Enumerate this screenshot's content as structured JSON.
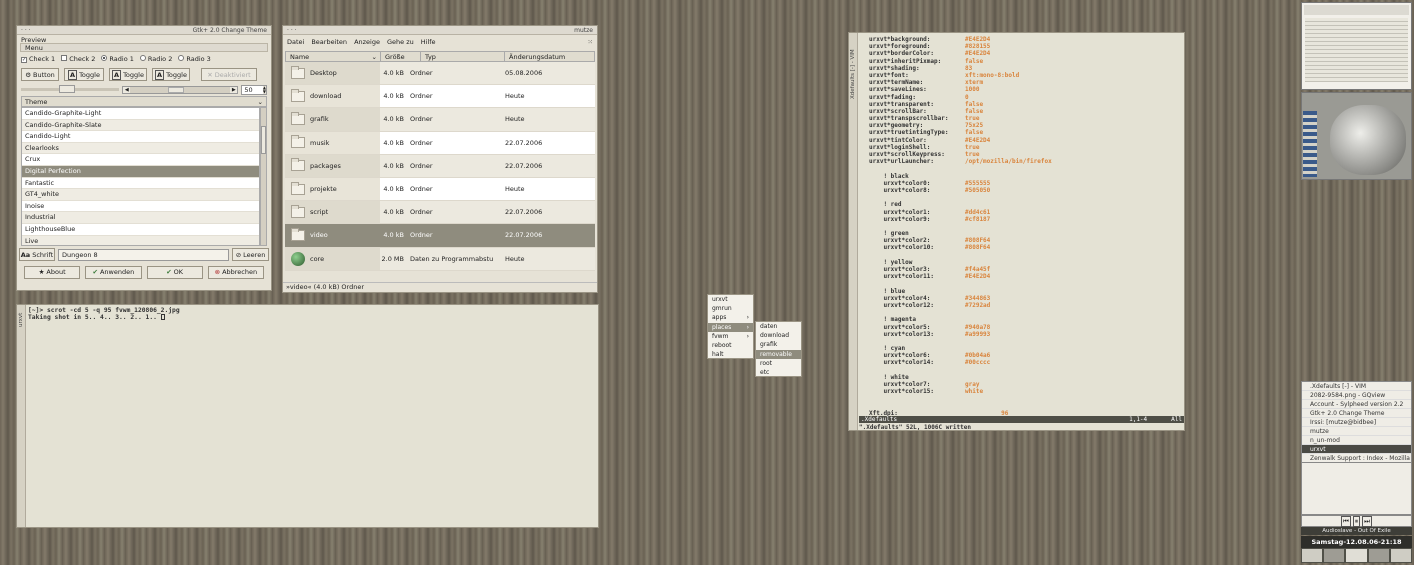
{
  "gtk": {
    "title": "Gtk+ 2.0 Change Theme",
    "preview": "Preview",
    "menu": "Menu",
    "check1": "Check 1",
    "check2": "Check 2",
    "radio1": "Radio 1",
    "radio2": "Radio 2",
    "radio3": "Radio 3",
    "button": "Button",
    "toggle": "Toggle",
    "disabled": "Deaktiviert",
    "spin": "50",
    "theme_header": "Theme",
    "themes": [
      "Candido-Graphite-Light",
      "Candido-Graphite-Slate",
      "Candido-Light",
      "Clearlooks",
      "Crux",
      "Digital Perfection",
      "Fantastic",
      "GT4_white",
      "Inoise",
      "Industrial",
      "LighthouseBlue",
      "Live"
    ],
    "font_label": "Schrift",
    "font_value": "Dungeon 8",
    "clear": "Leeren",
    "about": "About",
    "apply": "Anwenden",
    "ok": "OK",
    "cancel": "Abbrechen"
  },
  "fm": {
    "title": "mutze",
    "menus": [
      "Datei",
      "Bearbeiten",
      "Anzeige",
      "Gehe zu",
      "Hilfe"
    ],
    "cols": [
      "Name",
      "Größe",
      "Typ",
      "Änderungsdatum"
    ],
    "rows": [
      {
        "name": "Desktop",
        "size": "4.0 kB",
        "type": "Ordner",
        "date": "05.08.2006"
      },
      {
        "name": "download",
        "size": "4.0 kB",
        "type": "Ordner",
        "date": "Heute"
      },
      {
        "name": "grafik",
        "size": "4.0 kB",
        "type": "Ordner",
        "date": "Heute"
      },
      {
        "name": "musik",
        "size": "4.0 kB",
        "type": "Ordner",
        "date": "22.07.2006"
      },
      {
        "name": "packages",
        "size": "4.0 kB",
        "type": "Ordner",
        "date": "22.07.2006"
      },
      {
        "name": "projekte",
        "size": "4.0 kB",
        "type": "Ordner",
        "date": "Heute"
      },
      {
        "name": "script",
        "size": "4.0 kB",
        "type": "Ordner",
        "date": "22.07.2006"
      },
      {
        "name": "video",
        "size": "4.0 kB",
        "type": "Ordner",
        "date": "22.07.2006"
      },
      {
        "name": "core",
        "size": "2.0 MB",
        "type": "Daten zu Programmabstu",
        "date": "Heute"
      }
    ],
    "status": "»video« (4.0 kB) Ordner"
  },
  "term": {
    "side": "urxvt",
    "line1": "[~]> scrot -cd 5 -q 95 fvwm_120806_2.jpg",
    "line2": "Taking shot in 5.. 4.. 3.. 2.. 1.. "
  },
  "menu": {
    "items": [
      "urxvt",
      "gmrun",
      "apps",
      "places",
      "fvwm",
      "reboot",
      "halt"
    ],
    "sub": [
      "daten",
      "download",
      "grafik",
      "removable",
      "root",
      "etc"
    ]
  },
  "vim": {
    "side": "Xdefaults [-] - VIM",
    "lines": [
      [
        "urxvt*background:",
        "#E4E2D4"
      ],
      [
        "urxvt*foreground:",
        "#828155"
      ],
      [
        "urxvt*borderColor:",
        "#E4E2D4"
      ],
      [
        "urxvt*inheritPixmap:",
        "false"
      ],
      [
        "urxvt*shading:",
        "83"
      ],
      [
        "urxvt*font:",
        "xft:mono-8:bold"
      ],
      [
        "urxvt*termName:",
        "xterm"
      ],
      [
        "urxvt*saveLines:",
        "1000"
      ],
      [
        "urxvt*fading:",
        "0"
      ],
      [
        "urxvt*transparent:",
        "false"
      ],
      [
        "urxvt*scrollBar:",
        "false"
      ],
      [
        "urxvt*transpscrollbar:",
        "true"
      ],
      [
        "urxvt*geometry:",
        "75x25"
      ],
      [
        "urxvt*truetintingType:",
        "false"
      ],
      [
        "urxvt*tintColor:",
        "#E4E2D4"
      ],
      [
        "urxvt*loginShell:",
        "true"
      ],
      [
        "urxvt*scrollKeypress:",
        "true"
      ],
      [
        "urxvt*urlLauncher:",
        "/opt/mozilla/bin/firefox"
      ],
      [
        "",
        ""
      ],
      [
        "    ! black",
        ""
      ],
      [
        "    urxvt*color0:",
        "#555555"
      ],
      [
        "    urxvt*color8:",
        "#505050"
      ],
      [
        "",
        ""
      ],
      [
        "    ! red",
        ""
      ],
      [
        "    urxvt*color1:",
        "#dd4c61"
      ],
      [
        "    urxvt*color9:",
        "#cf8187"
      ],
      [
        "",
        ""
      ],
      [
        "    ! green",
        ""
      ],
      [
        "    urxvt*color2:",
        "#808F64"
      ],
      [
        "    urxvt*color10:",
        "#808F64"
      ],
      [
        "",
        ""
      ],
      [
        "    ! yellow",
        ""
      ],
      [
        "    urxvt*color3:",
        "#f4a45f"
      ],
      [
        "    urxvt*color11:",
        "#E4E2D4"
      ],
      [
        "",
        ""
      ],
      [
        "    ! blue",
        ""
      ],
      [
        "    urxvt*color4:",
        "#344863"
      ],
      [
        "    urxvt*color12:",
        "#7292ad"
      ],
      [
        "",
        ""
      ],
      [
        "    ! magenta",
        ""
      ],
      [
        "    urxvt*color5:",
        "#940a78"
      ],
      [
        "    urxvt*color13:",
        "#a99993"
      ],
      [
        "",
        ""
      ],
      [
        "    ! cyan",
        ""
      ],
      [
        "    urxvt*color6:",
        "#0b04a6"
      ],
      [
        "    urxvt*color14:",
        "#00cccc"
      ],
      [
        "",
        ""
      ],
      [
        "    ! white",
        ""
      ],
      [
        "    urxvt*color7:",
        "gray"
      ],
      [
        "    urxvt*color15:",
        "white"
      ],
      [
        "",
        ""
      ],
      [
        "Xft.dpi:",
        "          96"
      ]
    ],
    "status_file": ".Xdefaults",
    "status_pos": "1,1-4",
    "status_all": "All",
    "msg": "\".Xdefaults\" 52L, 1006C written"
  },
  "panel": {
    "windows": [
      ".Xdefaults [-] - VIM",
      "2082-9584.png - GQview",
      "Account - Sylpheed version 2.2",
      "Gtk+ 2.0 Change Theme",
      "Irssi: [mutze@bidbee]",
      "mutze",
      "n_un-mod",
      "urxvt",
      "Zenwalk Support : Index - Mozilla"
    ],
    "music": "Audioslave - Out Of Exile",
    "clock": "Samstag-12.08.06-21:18"
  }
}
